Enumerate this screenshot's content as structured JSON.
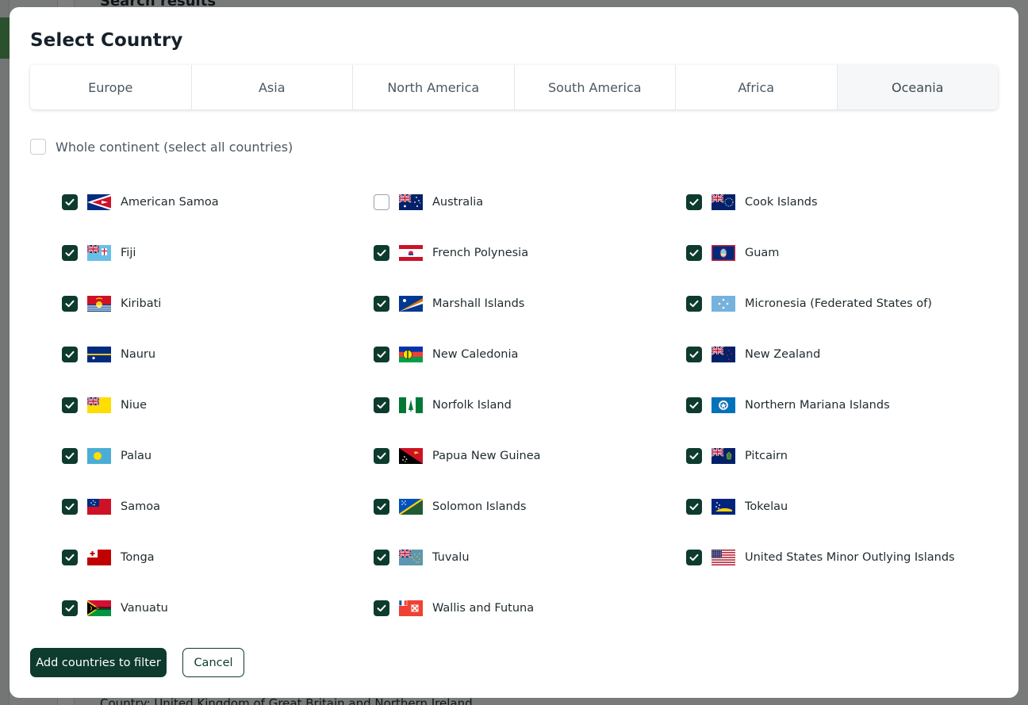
{
  "background": {
    "heading": "Search results",
    "footer_text": "Country: United Kingdom of Great Britain and Northern Ireland"
  },
  "modal": {
    "title": "Select Country",
    "tabs": [
      {
        "label": "Europe",
        "active": false
      },
      {
        "label": "Asia",
        "active": false
      },
      {
        "label": "North America",
        "active": false
      },
      {
        "label": "South America",
        "active": false
      },
      {
        "label": "Africa",
        "active": false
      },
      {
        "label": "Oceania",
        "active": true
      }
    ],
    "whole_continent": {
      "label": "Whole continent (select all countries)",
      "checked": false
    },
    "countries": [
      {
        "name": "American Samoa",
        "checked": true,
        "flag": "flag-american-samoa"
      },
      {
        "name": "Australia",
        "checked": false,
        "flag": "flag-australia"
      },
      {
        "name": "Cook Islands",
        "checked": true,
        "flag": "flag-cook-islands"
      },
      {
        "name": "Fiji",
        "checked": true,
        "flag": "flag-fiji"
      },
      {
        "name": "French Polynesia",
        "checked": true,
        "flag": "flag-french-polynesia"
      },
      {
        "name": "Guam",
        "checked": true,
        "flag": "flag-guam"
      },
      {
        "name": "Kiribati",
        "checked": true,
        "flag": "flag-kiribati"
      },
      {
        "name": "Marshall Islands",
        "checked": true,
        "flag": "flag-marshall-islands"
      },
      {
        "name": "Micronesia (Federated States of)",
        "checked": true,
        "flag": "flag-micronesia"
      },
      {
        "name": "Nauru",
        "checked": true,
        "flag": "flag-nauru"
      },
      {
        "name": "New Caledonia",
        "checked": true,
        "flag": "flag-new-caledonia"
      },
      {
        "name": "New Zealand",
        "checked": true,
        "flag": "flag-new-zealand"
      },
      {
        "name": "Niue",
        "checked": true,
        "flag": "flag-niue"
      },
      {
        "name": "Norfolk Island",
        "checked": true,
        "flag": "flag-norfolk-island"
      },
      {
        "name": "Northern Mariana Islands",
        "checked": true,
        "flag": "flag-northern-mariana-islands"
      },
      {
        "name": "Palau",
        "checked": true,
        "flag": "flag-palau"
      },
      {
        "name": "Papua New Guinea",
        "checked": true,
        "flag": "flag-papua-new-guinea"
      },
      {
        "name": "Pitcairn",
        "checked": true,
        "flag": "flag-pitcairn"
      },
      {
        "name": "Samoa",
        "checked": true,
        "flag": "flag-samoa"
      },
      {
        "name": "Solomon Islands",
        "checked": true,
        "flag": "flag-solomon-islands"
      },
      {
        "name": "Tokelau",
        "checked": true,
        "flag": "flag-tokelau"
      },
      {
        "name": "Tonga",
        "checked": true,
        "flag": "flag-tonga"
      },
      {
        "name": "Tuvalu",
        "checked": true,
        "flag": "flag-tuvalu"
      },
      {
        "name": "United States Minor Outlying Islands",
        "checked": true,
        "flag": "flag-us-minor-outlying-islands"
      },
      {
        "name": "Vanuatu",
        "checked": true,
        "flag": "flag-vanuatu"
      },
      {
        "name": "Wallis and Futuna",
        "checked": true,
        "flag": "flag-wallis-and-futuna"
      }
    ],
    "primary_button": "Add countries to filter",
    "secondary_button": "Cancel"
  },
  "colors": {
    "accent": "#0d3b2e",
    "checkbox_border": "#9aa3a8",
    "overlay": "#7d7f80"
  }
}
